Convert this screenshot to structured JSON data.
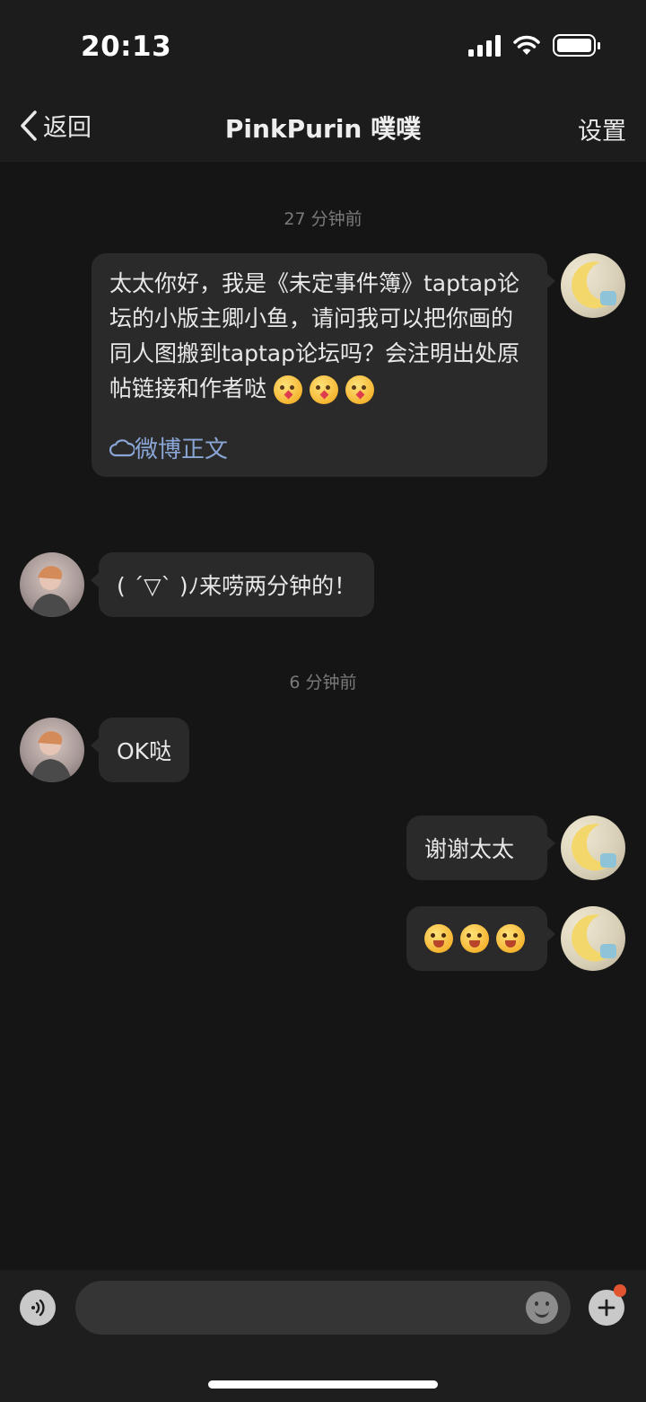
{
  "status": {
    "time": "20:13"
  },
  "nav": {
    "back_label": "返回",
    "title": "PinkPurin 噗噗",
    "settings_label": "设置"
  },
  "timestamps": [
    "27 分钟前",
    "6 分钟前"
  ],
  "messages": [
    {
      "side": "right",
      "text": "太太你好，我是《未定事件簿》taptap论坛的小版主卿小鱼，请问我可以把你画的同人图搬到taptap论坛吗？会注明出处原帖链接和作者哒",
      "emoji_count": 3,
      "emoji": "blowing-kiss-emoji",
      "link": "微博正文"
    },
    {
      "side": "left",
      "text": "( ´▽` )ﾉ来唠两分钟的！"
    },
    {
      "side": "left",
      "text": "OK哒"
    },
    {
      "side": "right",
      "text": "谢谢太太"
    },
    {
      "side": "right",
      "emoji_count": 3,
      "emoji": "smiling-hearts-emoji"
    }
  ],
  "icons": {
    "back": "chevron-left-icon",
    "weibo": "weibo-cloud-icon",
    "voice": "voice-icon",
    "emoji": "smile-icon",
    "plus": "plus-icon"
  },
  "colors": {
    "background": "#151515",
    "bubble": "#2a2a2a",
    "link": "#8aa6d6",
    "badge": "#e2542f"
  }
}
